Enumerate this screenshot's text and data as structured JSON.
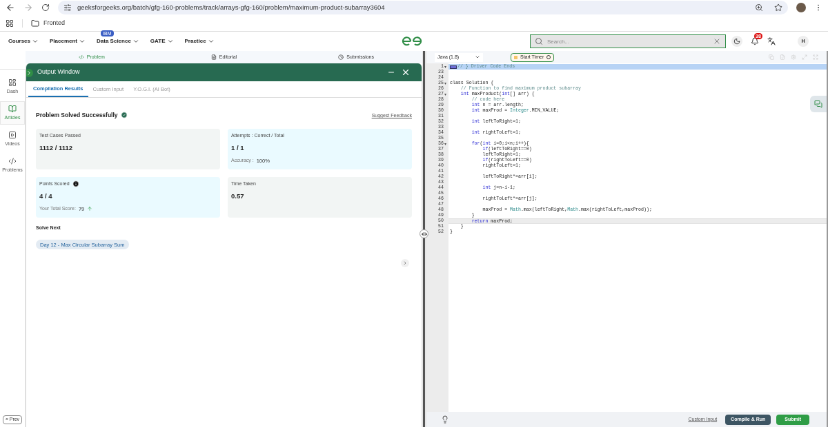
{
  "browser": {
    "url": "geeksforgeeks.org/batch/gfg-160-problems/track/arrays-gfg-160/problem/maximum-product-subarray3604",
    "bookmarks": [
      "Fronted"
    ]
  },
  "nav": {
    "items": [
      {
        "label": "Courses"
      },
      {
        "label": "Placement"
      },
      {
        "label": "Data Science",
        "badge": "IBM"
      },
      {
        "label": "GATE"
      },
      {
        "label": "Practice"
      }
    ],
    "search": {
      "placeholder": "Search..."
    },
    "notifications": "38",
    "avatar": "H"
  },
  "problem_tabs": [
    {
      "label": "Problem",
      "selected": true
    },
    {
      "label": "Editorial",
      "selected": false
    },
    {
      "label": "Submissions",
      "selected": false
    }
  ],
  "sidebar": {
    "items": [
      {
        "label": "Dash",
        "selected": false
      },
      {
        "label": "Articles",
        "selected": true
      },
      {
        "label": "Videos",
        "selected": false
      },
      {
        "label": "Problems",
        "selected": false
      }
    ],
    "prev": "« Prev"
  },
  "output": {
    "title": "Output Window",
    "tabs": [
      {
        "label": "Compilation Results",
        "selected": true
      },
      {
        "label": "Custom Input",
        "selected": false
      },
      {
        "label": "Y.O.G.I. (AI Bot)",
        "selected": false
      }
    ],
    "status": "Problem Solved Successfully",
    "feedback": "Suggest Feedback",
    "cards": [
      {
        "title": "Test Cases Passed",
        "value": "1112 / 1112",
        "kind": "neutral"
      },
      {
        "title": "Attempts : Correct / Total",
        "value": "1 / 1",
        "kind": "info",
        "note_label": "Accuracy :",
        "note_value": "100%"
      },
      {
        "title": "Points Scored",
        "value": "4 / 4",
        "kind": "info",
        "info": true,
        "note_label": "Your Total Score:",
        "note_value": "79",
        "trend_up": true
      },
      {
        "title": "Time Taken",
        "value": "0.57",
        "kind": "neutral"
      }
    ],
    "solve_next": {
      "heading": "Solve Next",
      "items": [
        "Day 12 - Max Circular Subarray Sum"
      ]
    }
  },
  "editor": {
    "language": "Java (1.8)",
    "timer": "Start Timer",
    "custom_input": "Custom Input",
    "compile": "Compile & Run",
    "submit": "Submit",
    "lines": [
      {
        "n": "1",
        "fold": true,
        "selected": true,
        "current": false,
        "tokens": [
          {
            "kind": "comment",
            "t": "// } Driver Code Ends"
          }
        ]
      },
      {
        "n": "23",
        "fold": false,
        "selected": false,
        "current": false
      },
      {
        "n": "24",
        "fold": false,
        "selected": false,
        "current": false
      },
      {
        "n": "25",
        "fold": true,
        "selected": false,
        "current": false,
        "tokens": [
          {
            "kind": "plain",
            "t": "class Solution {"
          }
        ]
      },
      {
        "n": "26",
        "fold": false,
        "selected": false,
        "current": false,
        "tokens": [
          {
            "kind": "comment",
            "t": "    // Function to find maximum product subarray"
          }
        ]
      },
      {
        "n": "27",
        "fold": true,
        "selected": false,
        "current": false,
        "tokens": [
          {
            "kind": "keyword",
            "t": "    int"
          },
          {
            "kind": "plain",
            "t": " maxProduct("
          },
          {
            "kind": "keyword",
            "t": "int"
          },
          {
            "kind": "plain",
            "t": "[] arr) {"
          }
        ]
      },
      {
        "n": "28",
        "fold": false,
        "selected": false,
        "current": false,
        "tokens": [
          {
            "kind": "comment",
            "t": "        // code here"
          }
        ]
      },
      {
        "n": "29",
        "fold": false,
        "selected": false,
        "current": false,
        "tokens": [
          {
            "kind": "keyword",
            "t": "        int"
          },
          {
            "kind": "plain",
            "t": " n = arr.length;"
          }
        ]
      },
      {
        "n": "30",
        "fold": false,
        "selected": false,
        "current": false,
        "tokens": [
          {
            "kind": "keyword",
            "t": "        int"
          },
          {
            "kind": "plain",
            "t": " maxProd = "
          },
          {
            "kind": "type",
            "t": "Integer"
          },
          {
            "kind": "plain",
            "t": ".MIN_VALUE;"
          }
        ]
      },
      {
        "n": "31",
        "fold": false,
        "selected": false,
        "current": false
      },
      {
        "n": "32",
        "fold": false,
        "selected": false,
        "current": false,
        "tokens": [
          {
            "kind": "keyword",
            "t": "        int"
          },
          {
            "kind": "plain",
            "t": " leftToRight=1;"
          }
        ]
      },
      {
        "n": "33",
        "fold": false,
        "selected": false,
        "current": false
      },
      {
        "n": "34",
        "fold": false,
        "selected": false,
        "current": false,
        "tokens": [
          {
            "kind": "keyword",
            "t": "        int"
          },
          {
            "kind": "plain",
            "t": " rightToLeft=1;"
          }
        ]
      },
      {
        "n": "35",
        "fold": false,
        "selected": false,
        "current": false
      },
      {
        "n": "36",
        "fold": true,
        "selected": false,
        "current": false,
        "tokens": [
          {
            "kind": "keyword",
            "t": "        for"
          },
          {
            "kind": "plain",
            "t": "("
          },
          {
            "kind": "keyword",
            "t": "int"
          },
          {
            "kind": "plain",
            "t": " i=0;i<n;i++){"
          }
        ]
      },
      {
        "n": "37",
        "fold": false,
        "selected": false,
        "current": false,
        "tokens": [
          {
            "kind": "keyword",
            "t": "            if"
          },
          {
            "kind": "plain",
            "t": "(leftToRight==0)"
          }
        ]
      },
      {
        "n": "38",
        "fold": false,
        "selected": false,
        "current": false,
        "tokens": [
          {
            "kind": "plain",
            "t": "            leftToRight=1;"
          }
        ]
      },
      {
        "n": "39",
        "fold": false,
        "selected": false,
        "current": false,
        "tokens": [
          {
            "kind": "keyword",
            "t": "            if"
          },
          {
            "kind": "plain",
            "t": "(rightToLeft==0)"
          }
        ]
      },
      {
        "n": "40",
        "fold": false,
        "selected": false,
        "current": false,
        "tokens": [
          {
            "kind": "plain",
            "t": "            rightToLeft=1;"
          }
        ]
      },
      {
        "n": "41",
        "fold": false,
        "selected": false,
        "current": false
      },
      {
        "n": "42",
        "fold": false,
        "selected": false,
        "current": false,
        "tokens": [
          {
            "kind": "plain",
            "t": "            leftToRight*=arr[i];"
          }
        ]
      },
      {
        "n": "43",
        "fold": false,
        "selected": false,
        "current": false
      },
      {
        "n": "44",
        "fold": false,
        "selected": false,
        "current": false,
        "tokens": [
          {
            "kind": "keyword",
            "t": "            int"
          },
          {
            "kind": "plain",
            "t": " j=n-i-1;"
          }
        ]
      },
      {
        "n": "45",
        "fold": false,
        "selected": false,
        "current": false
      },
      {
        "n": "46",
        "fold": false,
        "selected": false,
        "current": false,
        "tokens": [
          {
            "kind": "plain",
            "t": "            rightToLeft*=arr[j];"
          }
        ]
      },
      {
        "n": "47",
        "fold": false,
        "selected": false,
        "current": false
      },
      {
        "n": "48",
        "fold": false,
        "selected": false,
        "current": false,
        "tokens": [
          {
            "kind": "plain",
            "t": "            maxProd = "
          },
          {
            "kind": "type",
            "t": "Math"
          },
          {
            "kind": "plain",
            "t": ".max(leftToRight,"
          },
          {
            "kind": "type",
            "t": "Math"
          },
          {
            "kind": "plain",
            "t": ".max(rightToLeft,maxProd));"
          }
        ]
      },
      {
        "n": "49",
        "fold": false,
        "selected": false,
        "current": false,
        "tokens": [
          {
            "kind": "plain",
            "t": "        }"
          }
        ]
      },
      {
        "n": "50",
        "fold": false,
        "selected": false,
        "current": true,
        "tokens": [
          {
            "kind": "keyword",
            "t": "        return"
          },
          {
            "kind": "plain",
            "t": " maxProd;"
          }
        ]
      },
      {
        "n": "51",
        "fold": false,
        "selected": false,
        "current": false,
        "tokens": [
          {
            "kind": "plain",
            "t": "    }"
          }
        ]
      },
      {
        "n": "52",
        "fold": false,
        "selected": false,
        "current": false,
        "tokens": [
          {
            "kind": "plain",
            "t": "}"
          }
        ]
      }
    ]
  }
}
